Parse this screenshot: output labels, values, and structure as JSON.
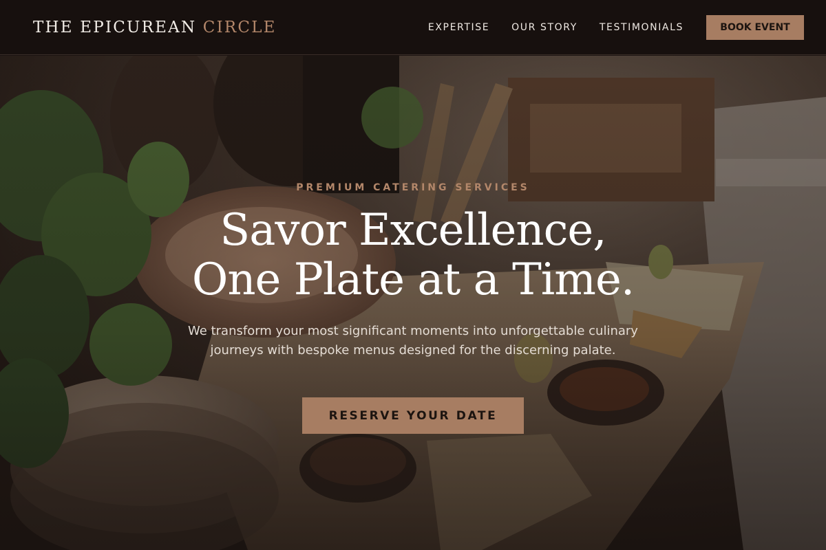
{
  "header": {
    "logo_main": "THE EPICUREAN",
    "logo_accent": "CIRCLE",
    "nav": [
      "EXPERTISE",
      "OUR STORY",
      "TESTIMONIALS"
    ],
    "book_label": "BOOK EVENT"
  },
  "hero": {
    "eyebrow": "PREMIUM CATERING SERVICES",
    "headline_line1": "Savor Excellence,",
    "headline_line2": "One Plate at a Time.",
    "subtext": "We transform your most significant moments into unforgettable culinary journeys with bespoke menus designed for the discerning palate.",
    "cta_label": "RESERVE YOUR DATE"
  },
  "colors": {
    "accent": "#b3876a",
    "button": "#a77d62",
    "header_bg": "#17100e"
  },
  "icons": []
}
